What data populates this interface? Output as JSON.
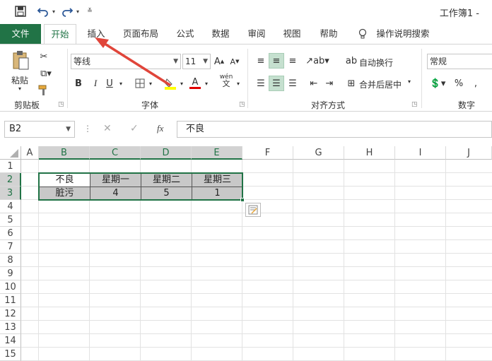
{
  "app": {
    "title": "工作簿1 -"
  },
  "tabs": {
    "file": "文件",
    "home": "开始",
    "insert": "插入",
    "page_layout": "页面布局",
    "formulas": "公式",
    "data": "数据",
    "review": "审阅",
    "view": "视图",
    "help": "帮助",
    "tell_me": "操作说明搜索"
  },
  "ribbon": {
    "clipboard": {
      "label": "剪贴板",
      "paste": "粘贴"
    },
    "font": {
      "label": "字体",
      "name": "等线",
      "size": "11",
      "bold": "B",
      "italic": "I",
      "underline": "U",
      "grow": "A",
      "shrink": "A",
      "font_color": "A",
      "wen": "wén"
    },
    "alignment": {
      "label": "对齐方式",
      "wrap": "自动换行",
      "merge": "合并后居中"
    },
    "number": {
      "label": "数字",
      "format": "常规",
      "percent": "%"
    }
  },
  "formula_bar": {
    "name_box": "B2",
    "fx": "fx",
    "content": "不良"
  },
  "grid": {
    "columns": [
      "A",
      "B",
      "C",
      "D",
      "E",
      "F",
      "G",
      "H",
      "I",
      "J"
    ],
    "rows": [
      "1",
      "2",
      "3",
      "4",
      "5",
      "6",
      "7",
      "8",
      "9",
      "10",
      "11",
      "12",
      "13",
      "14",
      "15"
    ],
    "header_row": [
      "不良",
      "星期一",
      "星期二",
      "星期三"
    ],
    "data_row": [
      "脏污",
      "4",
      "5",
      "1"
    ]
  },
  "colors": {
    "accent": "#217346",
    "arrow": "#e0453a",
    "selection_fill": "#c8c8c8"
  }
}
